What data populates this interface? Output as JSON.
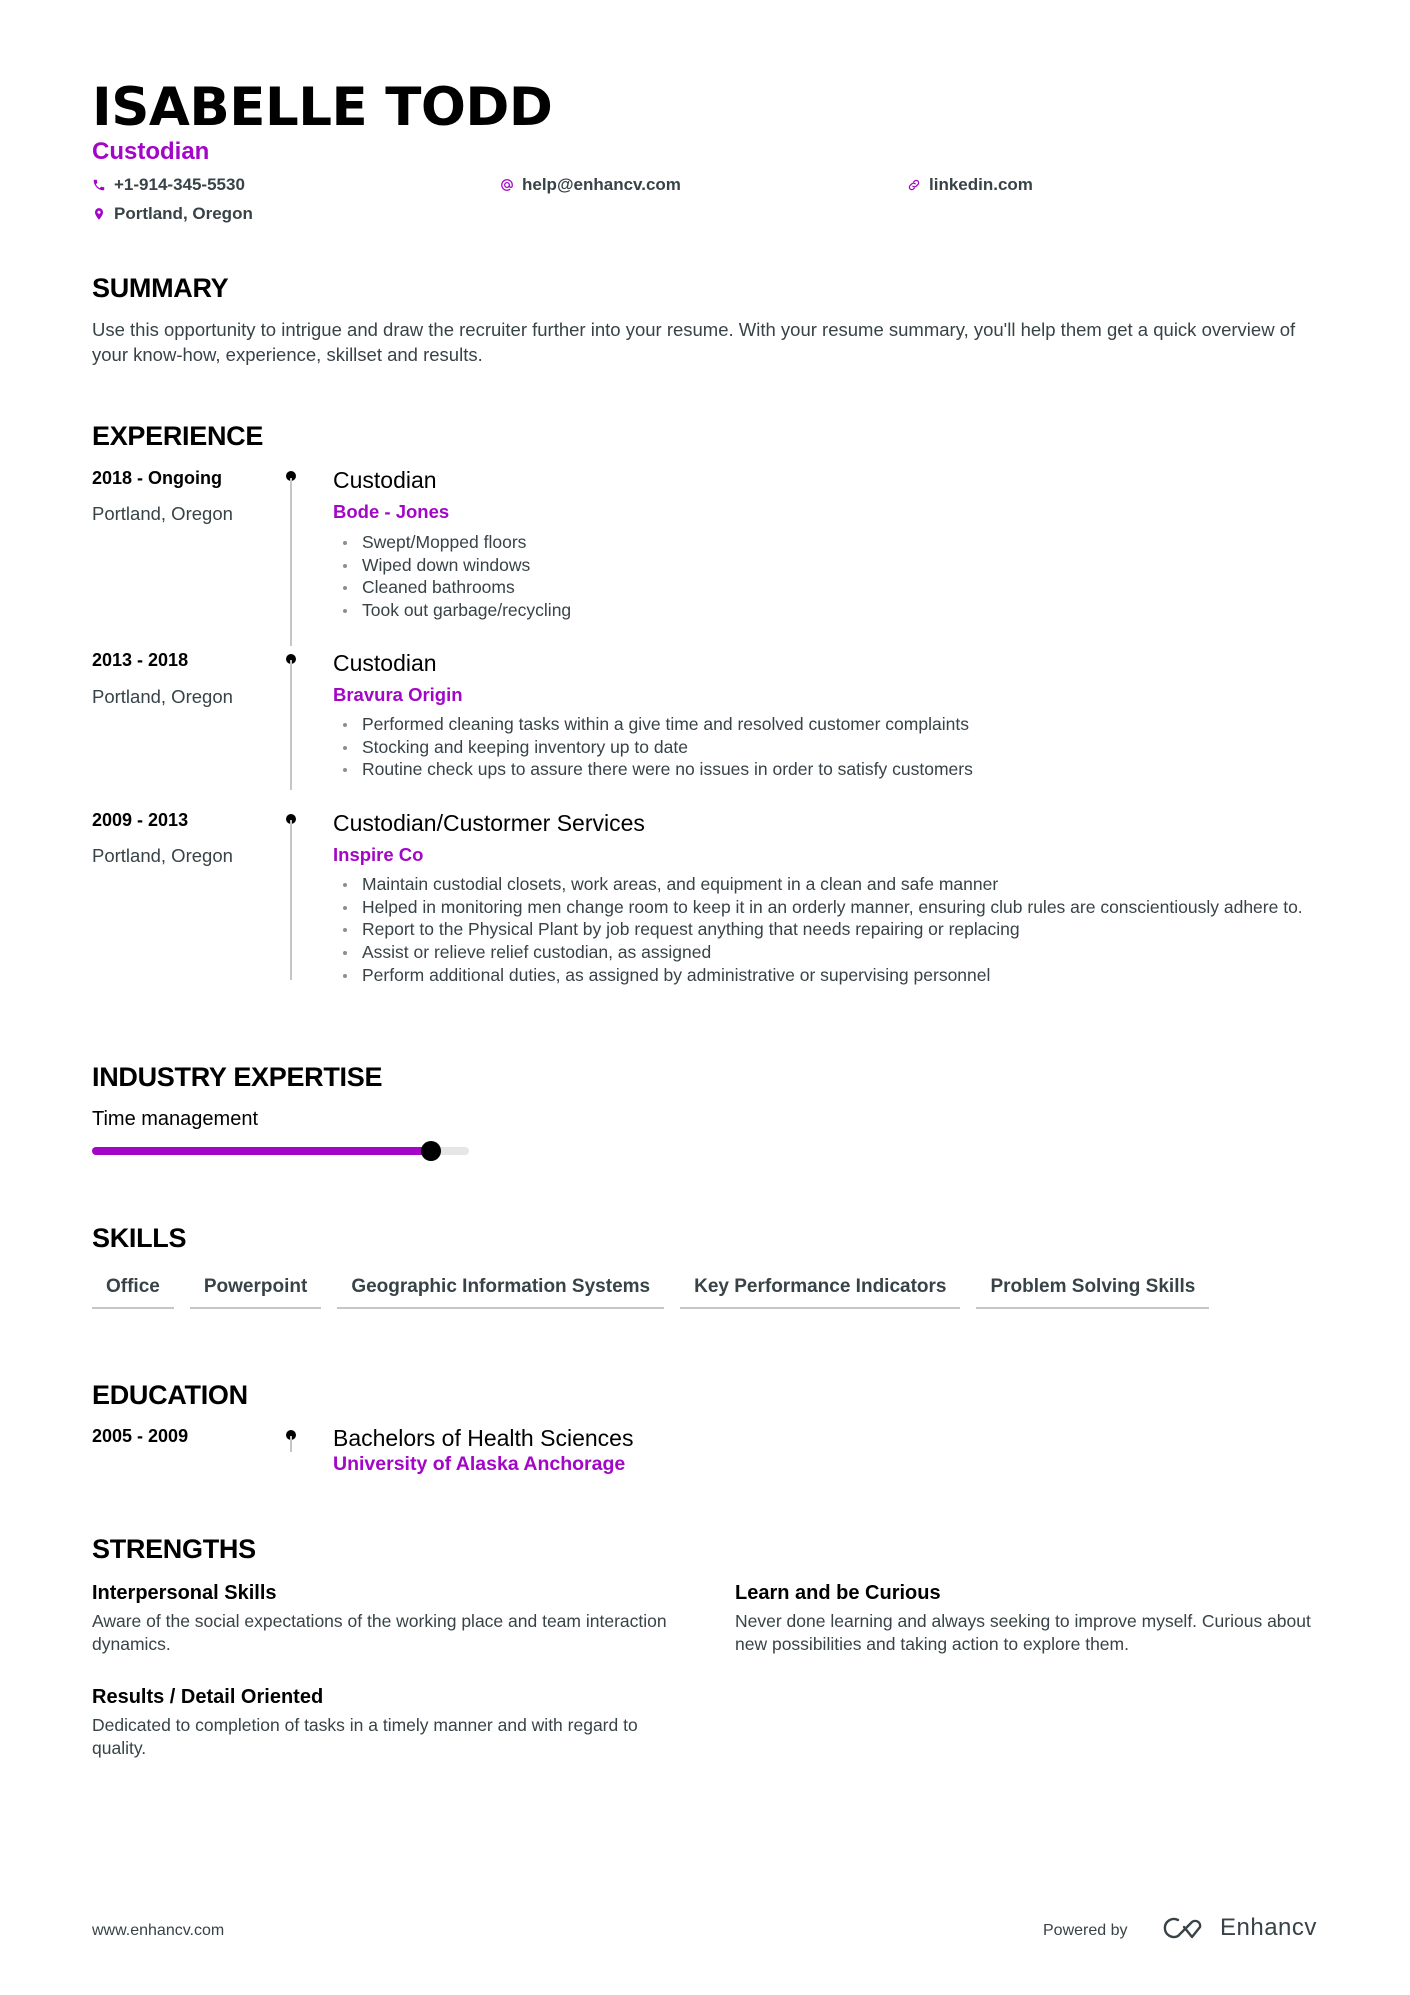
{
  "header": {
    "name": "ISABELLE TODD",
    "role": "Custodian",
    "contacts": [
      {
        "icon": "phone-icon",
        "text": "+1-914-345-5530"
      },
      {
        "icon": "at-icon",
        "text": "help@enhancv.com"
      },
      {
        "icon": "link-icon",
        "text": "linkedin.com"
      },
      {
        "icon": "location-pin-icon",
        "text": "Portland, Oregon"
      }
    ]
  },
  "colors": {
    "accent": "#a306c7",
    "text": "#384347",
    "heading": "#000000"
  },
  "summary": {
    "title": "SUMMARY",
    "text": "Use this opportunity to intrigue and draw the recruiter further into your resume. With your resume summary, you'll help them get a quick overview of your know-how, experience, skillset and results."
  },
  "experience": {
    "title": "EXPERIENCE",
    "items": [
      {
        "dates": "2018 - Ongoing",
        "location": "Portland, Oregon",
        "title": "Custodian",
        "company": "Bode - Jones",
        "bullets": [
          "Swept/Mopped floors",
          "Wiped down windows",
          "Cleaned bathrooms",
          "Took out garbage/recycling"
        ]
      },
      {
        "dates": "2013 - 2018",
        "location": "Portland, Oregon",
        "title": "Custodian",
        "company": "Bravura Origin",
        "bullets": [
          "Performed cleaning tasks within a give time and resolved customer complaints",
          "Stocking and keeping inventory up to date",
          "Routine check ups to assure there were no issues in order to satisfy customers"
        ]
      },
      {
        "dates": "2009 - 2013",
        "location": "Portland, Oregon",
        "title": "Custodian/Custormer Services",
        "company": "Inspire Co",
        "bullets": [
          "Maintain custodial closets, work areas, and equipment in a clean and safe manner",
          "Helped in monitoring men change room to keep it in an orderly manner, ensuring club rules are conscientiously adhere to.",
          "Report to the Physical Plant by job request anything that needs repairing or replacing",
          "Assist or relieve relief custodian, as assigned",
          "Perform additional duties, as assigned by administrative or supervising personnel"
        ]
      }
    ]
  },
  "expertise": {
    "title": "INDUSTRY EXPERTISE",
    "items": [
      {
        "label": "Time management",
        "level": 0.9
      }
    ]
  },
  "skills": {
    "title": "SKILLS",
    "items": [
      "Office",
      "Powerpoint",
      "Geographic Information Systems",
      "Key Performance Indicators",
      "Problem Solving Skills"
    ]
  },
  "education": {
    "title": "EDUCATION",
    "items": [
      {
        "dates": "2005 - 2009",
        "degree": "Bachelors of Health Sciences",
        "school": "University of Alaska Anchorage"
      }
    ]
  },
  "strengths": {
    "title": "STRENGTHS",
    "items": [
      {
        "title": "Interpersonal Skills",
        "text": "Aware of the social expectations of the working place and team interaction dynamics."
      },
      {
        "title": "Learn and be Curious",
        "text": "Never done learning and always seeking to improve myself. Curious about new possibilities and taking action to explore them."
      },
      {
        "title": "Results / Detail Oriented",
        "text": "Dedicated to completion of tasks in a timely manner and with regard to quality."
      }
    ]
  },
  "footer": {
    "url": "www.enhancv.com",
    "powered_by": "Powered by",
    "brand": "Enhancv"
  }
}
